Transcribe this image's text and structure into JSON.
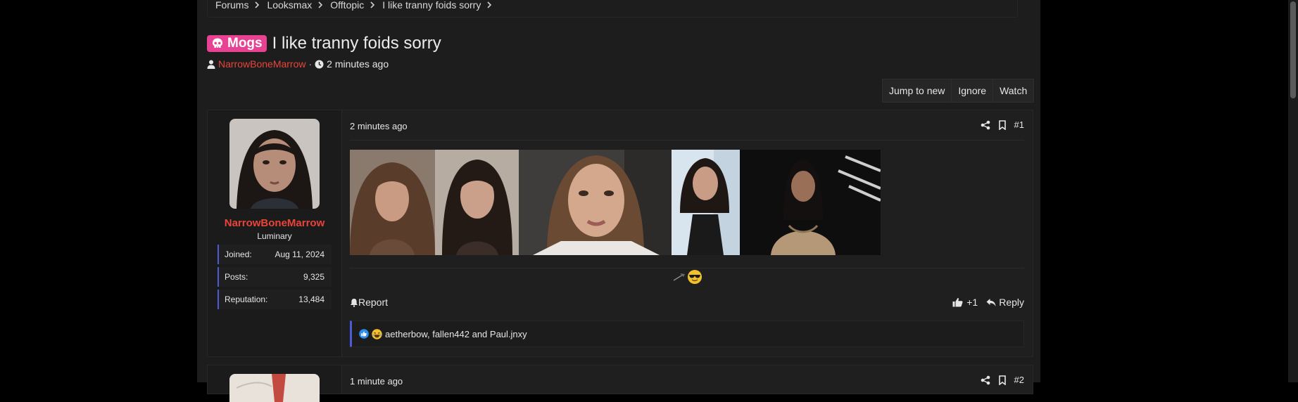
{
  "breadcrumbs": [
    "Forums",
    "Looksmax",
    "Offtopic",
    "I like tranny foids sorry"
  ],
  "thread": {
    "prefix": "Mogs",
    "title": "I like tranny foids sorry",
    "author": "NarrowBoneMarrow",
    "posted": "2 minutes ago"
  },
  "thread_buttons": [
    "Jump to new",
    "Ignore",
    "Watch"
  ],
  "post1": {
    "username": "NarrowBoneMarrow",
    "user_title": "Luminary",
    "stats": [
      {
        "label": "Joined:",
        "value": "Aug 11, 2024"
      },
      {
        "label": "Posts:",
        "value": "9,325"
      },
      {
        "label": "Reputation:",
        "value": "13,484"
      }
    ],
    "time": "2 minutes ago",
    "post_number": "#1",
    "report_label": "Report",
    "like_count": "+1",
    "reply_label": "Reply",
    "reactions_text": "aetherbow, fallen442 and Paul.jnxy"
  },
  "post2": {
    "time": "1 minute ago",
    "post_number": "#2"
  },
  "colors": {
    "accent_red": "#e8443a",
    "prefix_pink": "#e84393",
    "stat_border": "#4d5bd6"
  }
}
